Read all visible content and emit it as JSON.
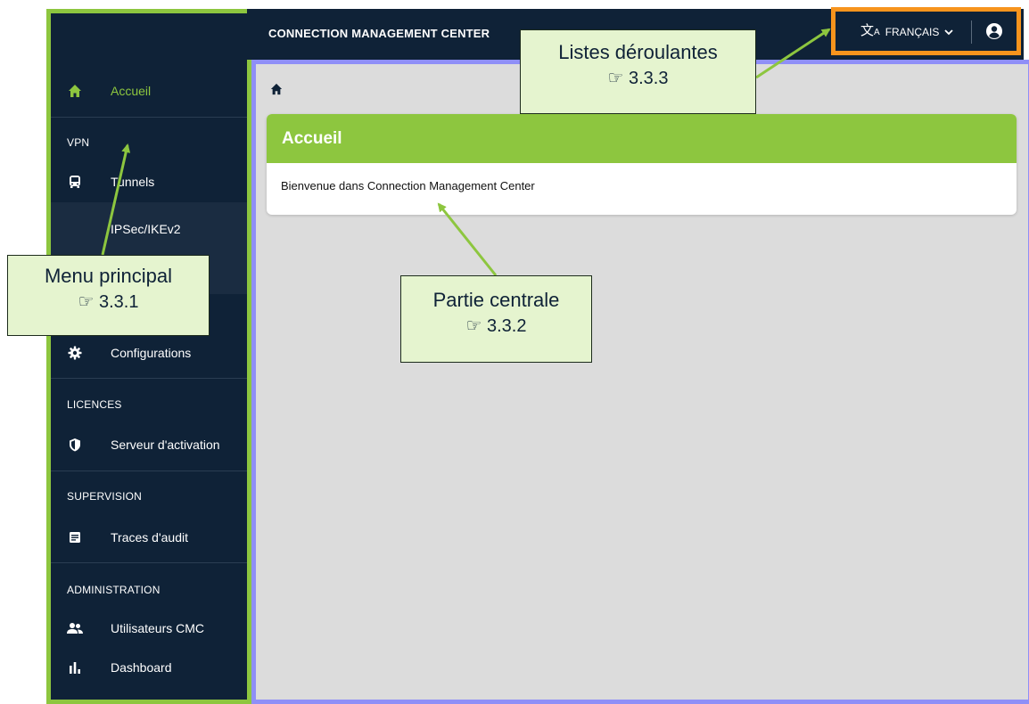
{
  "header": {
    "title": "CONNECTION MANAGEMENT CENTER"
  },
  "language": {
    "label": "FRANÇAIS"
  },
  "sidebar": {
    "home": "Accueil",
    "sections": {
      "vpn": "VPN",
      "licences": "LICENCES",
      "supervision": "SUPERVISION",
      "administration": "ADMINISTRATION"
    },
    "items": {
      "tunnels": "Tunnels",
      "ipsec": "IPSec/IKEv2",
      "configurations": "Configurations",
      "activation": "Serveur d'activation",
      "audit": "Traces d'audit",
      "users": "Utilisateurs CMC",
      "dashboard": "Dashboard"
    }
  },
  "main": {
    "card_title": "Accueil",
    "card_body": "Bienvenue dans Connection Management Center"
  },
  "annotations": {
    "menu": {
      "title": "Menu principal",
      "ref": "☞ 3.3.1"
    },
    "central": {
      "title": "Partie centrale",
      "ref": "☞ 3.3.2"
    },
    "dropdowns": {
      "title": "Listes déroulantes",
      "ref": "☞ 3.3.3"
    }
  },
  "colors": {
    "navy": "#0f2237",
    "green": "#8dc63f",
    "orange": "#f7941d",
    "lavender": "#8f8ff7",
    "callout_bg": "#e5f4cf"
  }
}
